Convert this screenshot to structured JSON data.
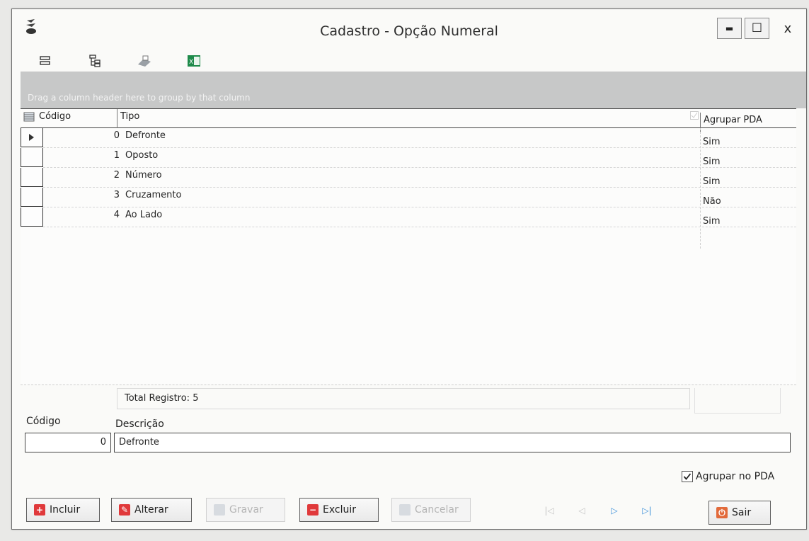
{
  "window": {
    "title": "Cadastro - Opção Numeral"
  },
  "title_controls": {
    "minimize": "▬",
    "maximize": "☐",
    "close": "x"
  },
  "toolbar": {
    "icons": [
      "expand-tree-icon",
      "collapse-tree-icon",
      "print-icon",
      "excel-export-icon"
    ]
  },
  "grid": {
    "group_hint": "Drag a column header here to group by that column",
    "columns": [
      "Código",
      "Tipo",
      "Agrupar PDA"
    ],
    "rows": [
      {
        "code": "0",
        "tipo": "Defronte",
        "pda": "Sim"
      },
      {
        "code": "1",
        "tipo": "Oposto",
        "pda": "Sim"
      },
      {
        "code": "2",
        "tipo": "Número",
        "pda": "Sim"
      },
      {
        "code": "3",
        "tipo": "Cruzamento",
        "pda": "Não"
      },
      {
        "code": "4",
        "tipo": "Ao Lado",
        "pda": "Sim"
      }
    ],
    "selected_row": 0,
    "footer_total": "Total Registro: 5"
  },
  "form": {
    "codigo_label": "Código",
    "codigo_value": "0",
    "descricao_label": "Descrição",
    "descricao_value": "Defronte",
    "agrupar_label": "Agrupar no PDA",
    "agrupar_checked": true
  },
  "buttons": {
    "incluir": "Incluir",
    "alterar": "Alterar",
    "gravar": "Gravar",
    "excluir": "Excluir",
    "cancelar": "Cancelar",
    "sair": "Sair"
  },
  "colors": {
    "group_panel": "#c7c8c8",
    "add_red": "#e0393b",
    "nav_blue": "#3a8fd9"
  }
}
